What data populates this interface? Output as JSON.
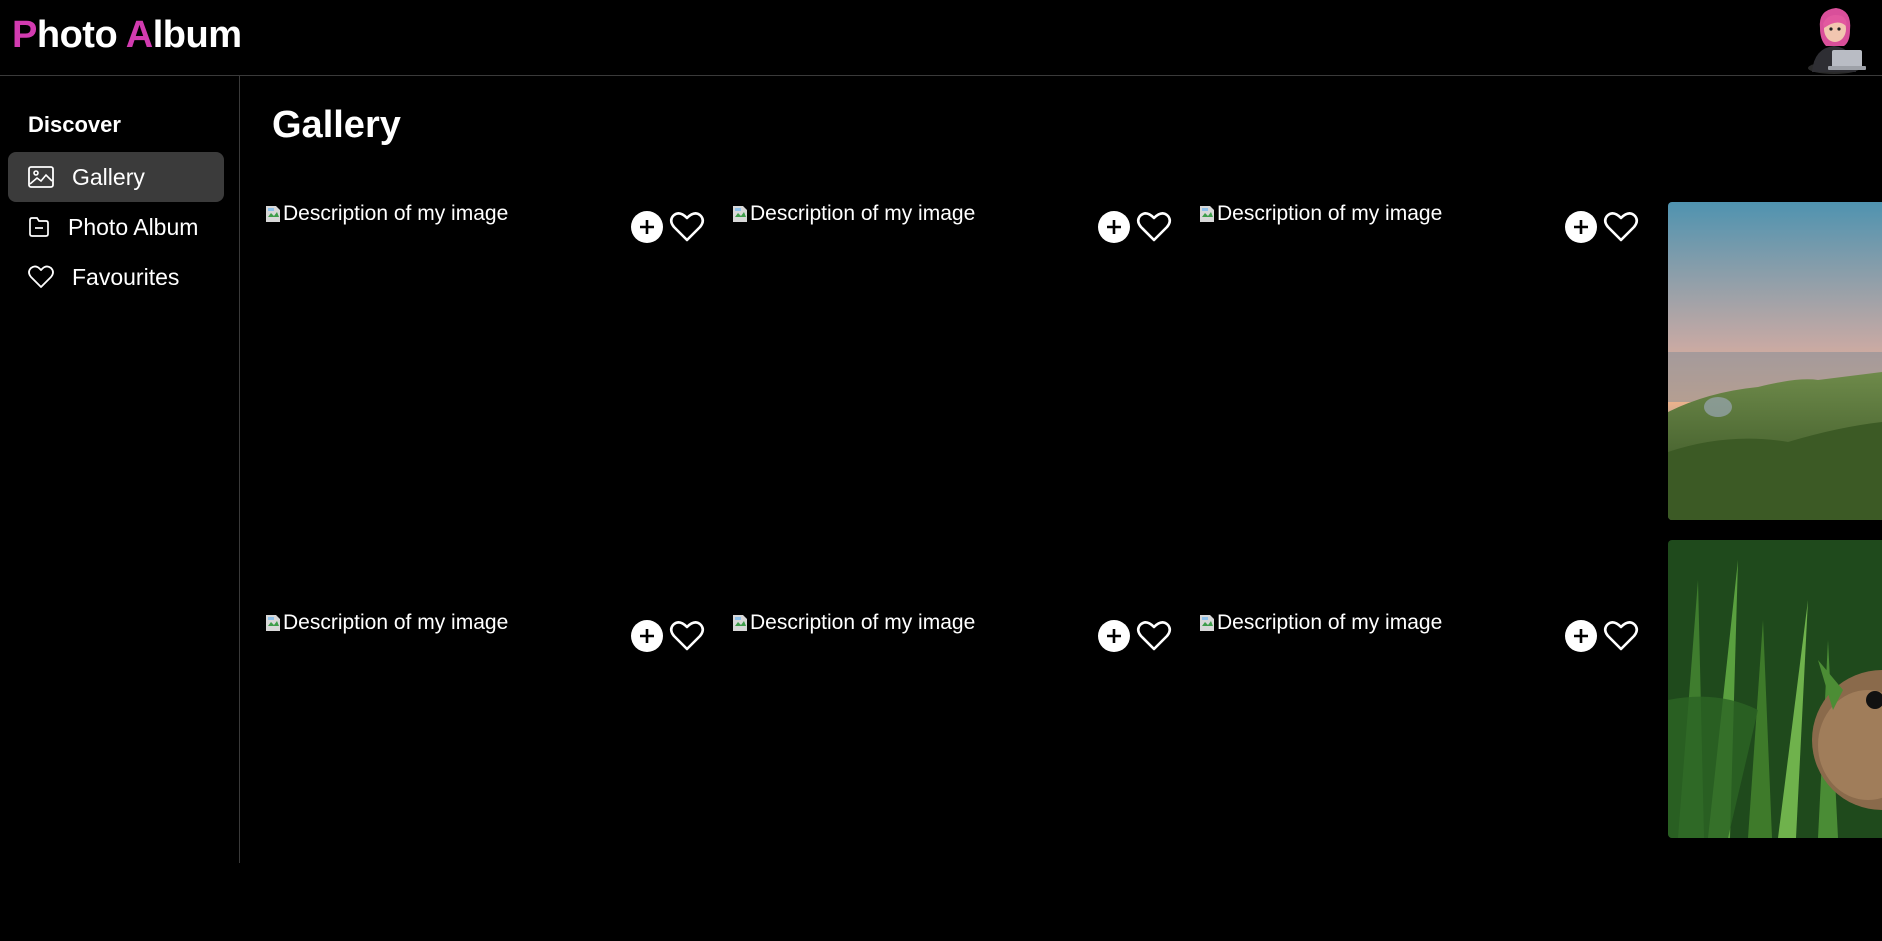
{
  "app": {
    "title_first_initial": "P",
    "title_first_rest": "hoto ",
    "title_second_initial": "A",
    "title_second_rest": "lbum",
    "accent_color": "#d23bb0"
  },
  "sidebar": {
    "heading": "Discover",
    "items": [
      {
        "label": "Gallery",
        "icon": "image-icon",
        "active": true
      },
      {
        "label": "Photo Album",
        "icon": "folder-icon",
        "active": false
      },
      {
        "label": "Favourites",
        "icon": "heart-icon",
        "active": false
      }
    ]
  },
  "main": {
    "title": "Gallery",
    "cards": [
      {
        "alt": "Description of my image"
      },
      {
        "alt": "Description of my image"
      },
      {
        "alt": "Description of my image"
      },
      {
        "alt": "Description of my image"
      },
      {
        "alt": "Description of my image"
      },
      {
        "alt": "Description of my image"
      }
    ],
    "photos": [
      {
        "subject": "hillside sunset city view"
      },
      {
        "subject": "rabbit in grass"
      }
    ]
  }
}
